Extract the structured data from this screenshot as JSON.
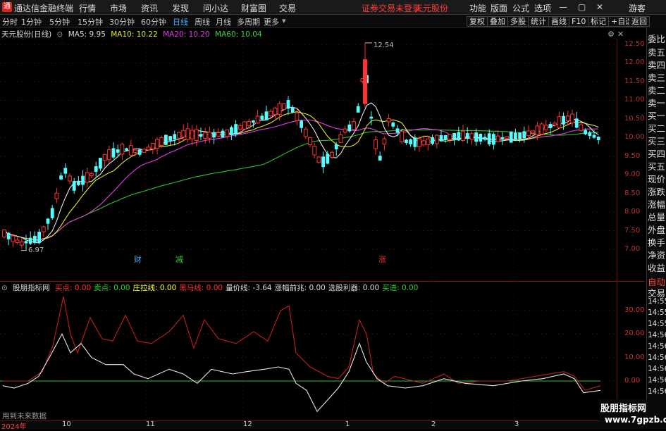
{
  "titlebar": {
    "app_title": "通达信金融终端",
    "menus": [
      "行情",
      "市场",
      "资讯",
      "发现",
      "问小达",
      "财富圈",
      "交易"
    ],
    "notice": "证券交易未登录",
    "stock_name": "天元股份",
    "right_menus": [
      "功能",
      "版面",
      "公式",
      "选项"
    ],
    "guest": "游客"
  },
  "timeframes": [
    "分时",
    "1分钟",
    "5分钟",
    "15分钟",
    "30分钟",
    "60分钟",
    "日线",
    "周线",
    "月线",
    "多周期",
    "更多"
  ],
  "active_timeframe": "日线",
  "toolbar_right": [
    "复权",
    "叠加",
    "多股",
    "统计",
    "画线",
    "F10",
    "标记",
    "+自选",
    "返回"
  ],
  "main_legend": {
    "title": "天元股份(日线)",
    "ma5": "MA5: 9.95",
    "ma10": "MA10: 10.22",
    "ma20": "MA20: 10.20",
    "ma60": "MA60: 10.04"
  },
  "sub_legend": {
    "title": "股朋指标网",
    "items": [
      {
        "label": "买点: 0.00",
        "color": "#ff3030"
      },
      {
        "label": "卖点: 0.00",
        "color": "#30d030"
      },
      {
        "label": "庄拉线: 0.00",
        "color": "#ffff40"
      },
      {
        "label": "黑马线: 0.00",
        "color": "#ff3030"
      },
      {
        "label": "量价线: -3.64",
        "color": "#dddddd"
      },
      {
        "label": "涨幅前兆: 0.00",
        "color": "#dddddd"
      },
      {
        "label": "选股利器: 0.00",
        "color": "#dddddd"
      },
      {
        "label": "买进: 0.00",
        "color": "#30d030"
      }
    ]
  },
  "price_axis": [
    "12.50",
    "12.00",
    "11.50",
    "11.00",
    "10.50",
    "10.00",
    "9.50",
    "9.00",
    "8.50",
    "8.00",
    "7.50",
    "7.00"
  ],
  "ind_axis": [
    "30.00",
    "20.00",
    "10.00",
    "0.00"
  ],
  "annotations": {
    "high": "12.54",
    "low": "6.97",
    "cai": "财",
    "jian": "减",
    "zhang": "涨"
  },
  "date_labels": [
    "2024年",
    "10",
    "11",
    "12",
    "1",
    "2",
    "3"
  ],
  "right_panel": [
    "委比",
    "卖五",
    "卖四",
    "卖三",
    "卖二",
    "卖一",
    "买一",
    "买二",
    "买三",
    "买四",
    "买五",
    "现价",
    "涨跌",
    "涨幅",
    "总量",
    "外盘",
    "换手",
    "净资",
    "收益",
    "自动",
    "交易",
    "14:55",
    "14:55",
    "14:55",
    "14:56",
    "14:56",
    "14:56",
    "14:56",
    "14:56",
    "14:56"
  ],
  "bottom_note": "用到未来数据",
  "watermark": {
    "line1": "股朋指标网",
    "line2": "www.7gpzb.com"
  }
}
